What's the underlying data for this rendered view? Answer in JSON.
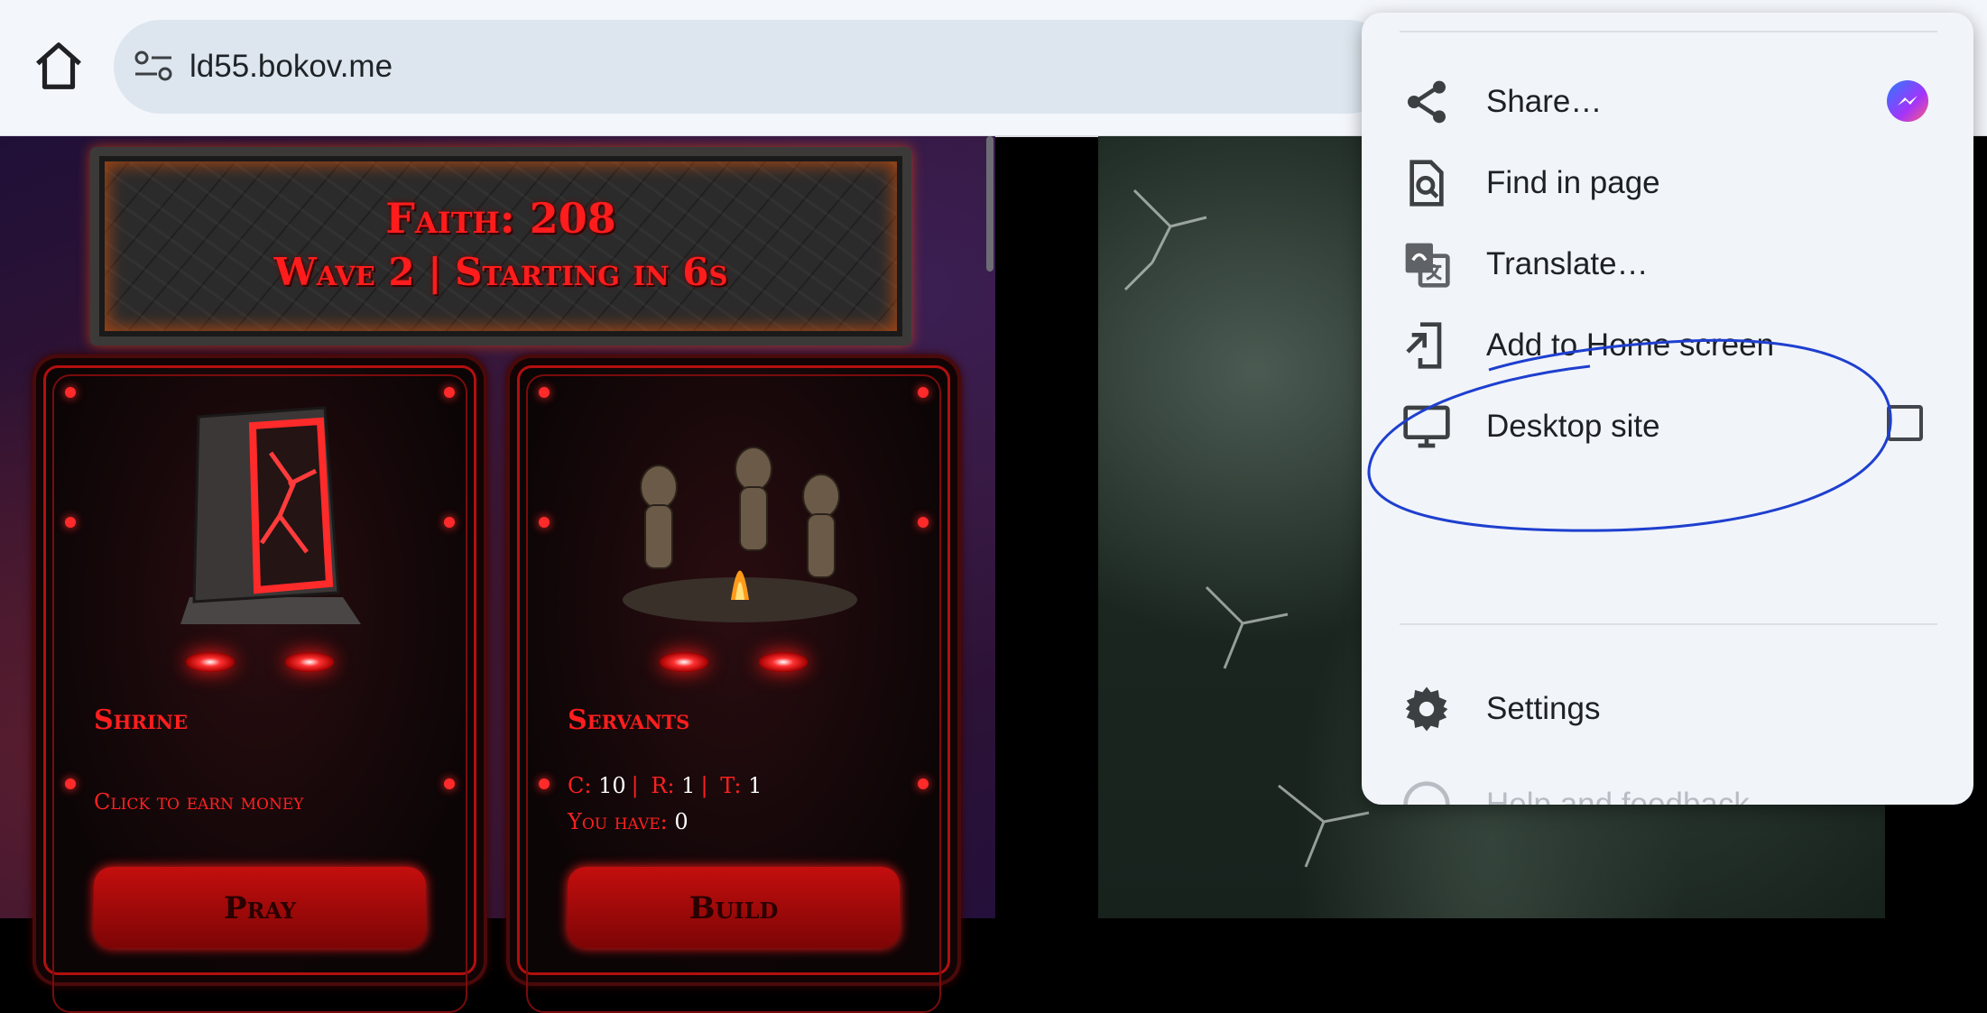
{
  "browser": {
    "url": "ld55.bokov.me",
    "home_icon": "home-icon",
    "site_settings_icon": "tune-icon"
  },
  "game": {
    "faith_line": "Faith: 208",
    "wave_line": "Wave 2 | Starting in 6s",
    "cards": [
      {
        "title": "Shrine",
        "description": "Click to earn money",
        "button": "Pray"
      },
      {
        "title": "Servants",
        "stats": {
          "c_label": "C:",
          "c_value": "10",
          "r_label": "R:",
          "r_value": "1",
          "t_label": "T:",
          "t_value": "1",
          "have_label": "You have:",
          "have_value": "0"
        },
        "button": "Build"
      }
    ]
  },
  "menu": {
    "items": [
      {
        "label": "Share…",
        "icon": "share-icon",
        "trailing_icon": "messenger-icon"
      },
      {
        "label": "Find in page",
        "icon": "find-in-page-icon"
      },
      {
        "label": "Translate…",
        "icon": "translate-icon"
      },
      {
        "label": "Add to Home screen",
        "icon": "add-to-home-icon"
      },
      {
        "label": "Desktop site",
        "icon": "monitor-icon",
        "checked": false
      },
      {
        "label": "Settings",
        "icon": "gear-icon"
      },
      {
        "label": "Help and feedback",
        "icon": "help-icon"
      }
    ]
  },
  "colors": {
    "menu_bg": "#f1f4f9",
    "annotation_ink": "#1e3fcf",
    "game_red": "#ff1c1c"
  }
}
